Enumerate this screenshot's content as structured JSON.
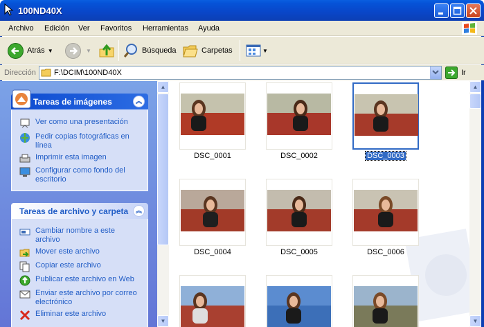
{
  "window": {
    "title": "100ND40X"
  },
  "menu": [
    "Archivo",
    "Edición",
    "Ver",
    "Favoritos",
    "Herramientas",
    "Ayuda"
  ],
  "toolbar": {
    "back": "Atrás",
    "search": "Búsqueda",
    "folders": "Carpetas"
  },
  "address": {
    "label": "Dirección",
    "path": "F:\\DCIM\\100ND40X",
    "go": "Ir"
  },
  "panel1": {
    "title": "Tareas de imágenes",
    "tasks": [
      "Ver como una presentación",
      "Pedir copias fotográficas en línea",
      "Imprimir esta imagen",
      "Configurar como fondo del escritorio"
    ]
  },
  "panel2": {
    "title": "Tareas de archivo y carpeta",
    "tasks": [
      "Cambiar nombre a este archivo",
      "Mover este archivo",
      "Copiar este archivo",
      "Publicar este archivo en Web",
      "Enviar este archivo por correo electrónico",
      "Eliminar este archivo"
    ]
  },
  "files": [
    "DSC_0001",
    "DSC_0002",
    "DSC_0003",
    "DSC_0004",
    "DSC_0005",
    "DSC_0006",
    "",
    "",
    ""
  ],
  "selected": "DSC_0003",
  "colors": {
    "title_bar": "#0a4fd6",
    "task_pane": "#6f8fdf",
    "selection": "#316ac5"
  }
}
